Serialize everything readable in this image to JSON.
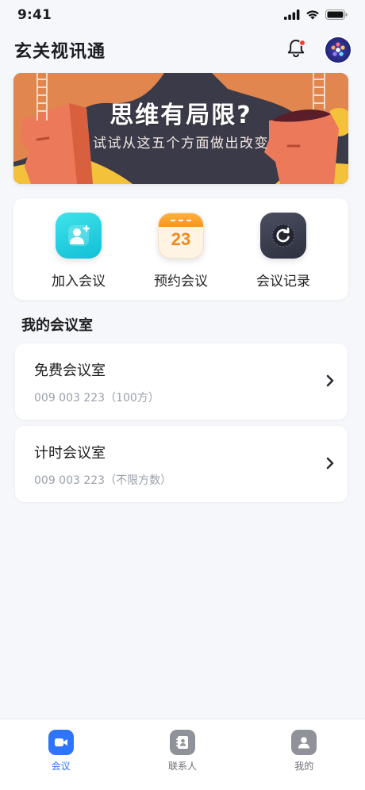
{
  "status_bar": {
    "time": "9:41"
  },
  "header": {
    "title": "玄关视讯通"
  },
  "banner": {
    "title": "思维有局限?",
    "subtitle": "试试从这五个方面做出改变"
  },
  "quick_actions": [
    {
      "label": "加入会议",
      "icon": "join-meeting-icon"
    },
    {
      "label": "预约会议",
      "icon": "calendar-icon",
      "calendar_day": "23"
    },
    {
      "label": "会议记录",
      "icon": "history-icon"
    }
  ],
  "my_rooms": {
    "section_title": "我的会议室",
    "items": [
      {
        "name": "免费会议室",
        "number": "009 003 223（100方）"
      },
      {
        "name": "计时会议室",
        "number": "009 003 223（不限方数）"
      }
    ]
  },
  "tab_bar": {
    "items": [
      {
        "label": "会议",
        "icon": "video-camera-icon",
        "active": true
      },
      {
        "label": "联系人",
        "icon": "contacts-icon",
        "active": false
      },
      {
        "label": "我的",
        "icon": "user-icon",
        "active": false
      }
    ]
  },
  "colors": {
    "accent": "#2f74ff",
    "background": "#f6f7fb",
    "join_icon": "#1fd0e0",
    "calendar_icon": "#f79420",
    "history_icon": "#3a3d4d",
    "notification_dot": "#ff3b30"
  }
}
